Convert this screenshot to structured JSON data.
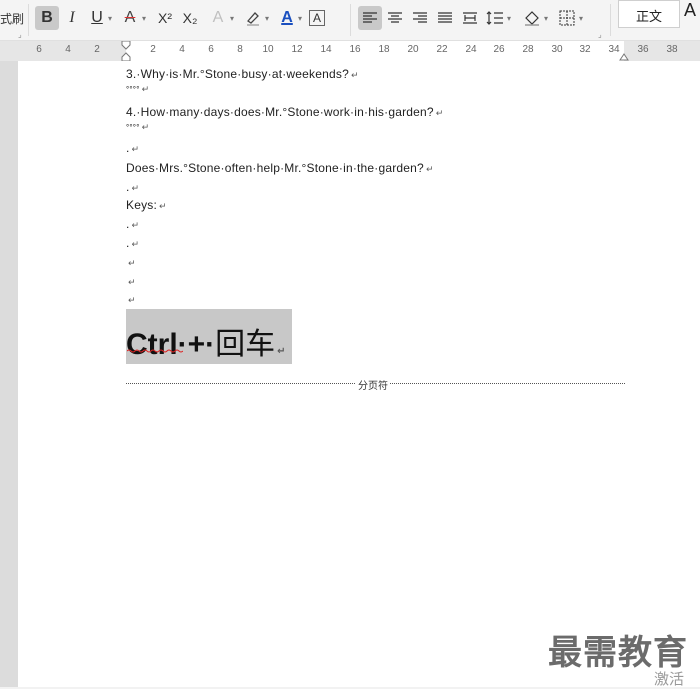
{
  "toolbar": {
    "format_painter_label": "式刷",
    "bold": "B",
    "italic": "I",
    "underline": "U",
    "font_color_a": "A",
    "superscript": "X²",
    "subscript": "X₂",
    "text_effect": "A",
    "font_color": "A",
    "char_border": "A",
    "style_normal_label": "正文",
    "style_next_label": "A"
  },
  "ruler": {
    "ticks": [
      "6",
      "4",
      "2",
      "2",
      "4",
      "6",
      "8",
      "10",
      "12",
      "14",
      "16",
      "18",
      "20",
      "22",
      "24",
      "26",
      "28",
      "30",
      "32",
      "34",
      "36",
      "38"
    ]
  },
  "document": {
    "lines": [
      "3.·Why·is·Mr.°Stone·busy·at·weekends?",
      "°°°°",
      "4.·How·many·days·does·Mr.°Stone·work·in·his·garden?",
      "°°°°",
      ".",
      "Does·Mrs.°Stone·often·help·Mr.°Stone·in·the·garden?",
      ".",
      "Keys:",
      ".",
      ".",
      "",
      "",
      ""
    ],
    "paragraph_mark": "↵",
    "ctrl_word": "Ctrl",
    "ctrl_plus": "·+·",
    "ctrl_cn": "回车",
    "page_break_label": "分页符"
  },
  "watermark": {
    "brand": "最需教育",
    "activate": "激活"
  }
}
